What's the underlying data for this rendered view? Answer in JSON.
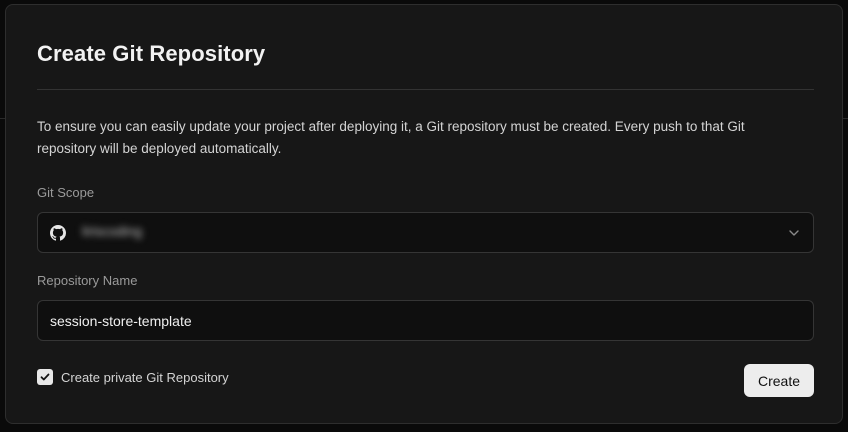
{
  "dialog": {
    "title": "Create Git Repository",
    "description": "To ensure you can easily update your project after deploying it, a Git repository must be created. Every push to that Git repository will be deployed automatically."
  },
  "git_scope": {
    "label": "Git Scope",
    "selected_value": "liriscoding",
    "icon": "github-icon"
  },
  "repository_name": {
    "label": "Repository Name",
    "value": "session-store-template"
  },
  "private_repo": {
    "label": "Create private Git Repository",
    "checked": true
  },
  "actions": {
    "create_label": "Create"
  },
  "colors": {
    "modal_bg": "#171717",
    "field_bg": "#0f0f0f",
    "border": "#353535",
    "button_bg": "#ededed"
  }
}
